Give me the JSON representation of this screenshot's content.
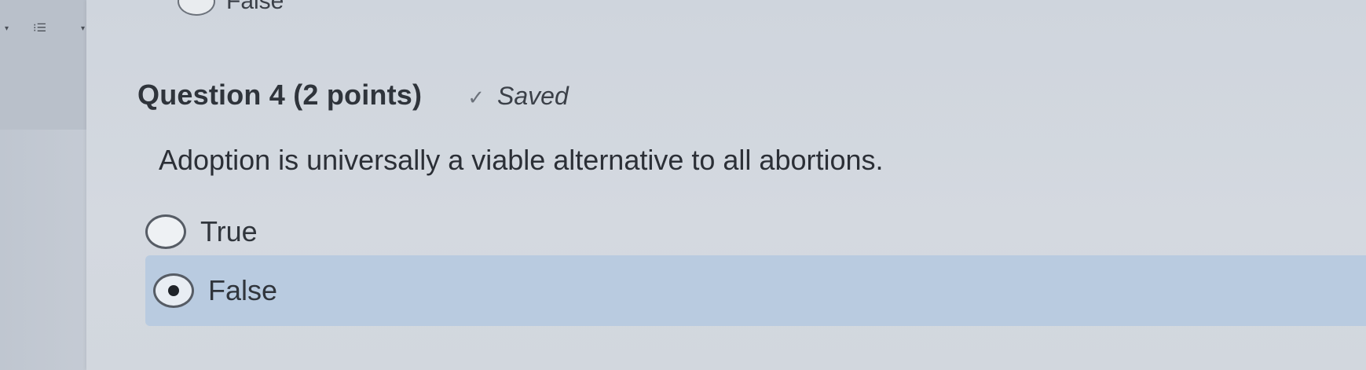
{
  "toolbar": {
    "caret_left_icon": "caret-down-icon",
    "list_icon": "bullet-list-icon",
    "caret_right_icon": "caret-down-icon",
    "caret_glyph": "▾",
    "list_glyph": "⁝☰"
  },
  "previous_question": {
    "option_label": "False"
  },
  "question": {
    "title": "Question 4 (2 points)",
    "saved_glyph": "✓",
    "saved_label": "Saved",
    "text": "Adoption is universally a viable alternative to all abortions.",
    "options": [
      {
        "label": "True",
        "selected": false
      },
      {
        "label": "False",
        "selected": true
      }
    ]
  },
  "colors": {
    "selected_option_bg": "#b9cbe0",
    "panel_bg": "#d2d7de"
  }
}
